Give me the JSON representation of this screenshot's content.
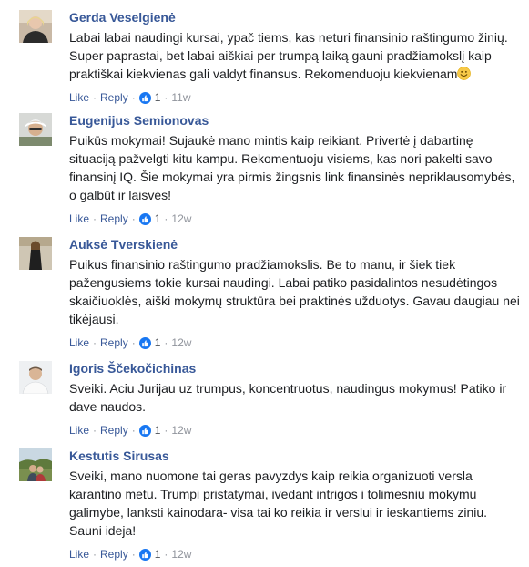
{
  "comments": [
    {
      "author": "Gerda Veselgienė",
      "text": "Labai labai naudingi kursai, ypač tiems, kas neturi finansinio raštingumo žinių. Super paprastai, bet labai aiškiai per trumpą laiką gauni pradžiamokslį kaip praktiškai kiekvienas gali valdyt finansus. Rekomenduoju kiekvienam",
      "emoji": "smiley-emoji-icon",
      "like_label": "Like",
      "reply_label": "Reply",
      "reaction_count": "1",
      "time": "11w"
    },
    {
      "author": "Eugenijus Semionovas",
      "text": "Puikūs mokymai! Sujaukė mano mintis kaip reikiant. Privertė į dabartinę situaciją pažvelgti kitu kampu. Rekomentuoju visiems, kas nori pakelti savo finansinį IQ. Šie mokymai yra pirmis žingsnis link finansinės nepriklausomybės, o galbūt ir laisvės!",
      "like_label": "Like",
      "reply_label": "Reply",
      "reaction_count": "1",
      "time": "12w"
    },
    {
      "author": "Auksė Tverskienė",
      "text": "Puikus finansinio raštingumo pradžiamokslis. Be to manu, ir šiek tiek pažengusiems tokie kursai naudingi. Labai patiko pasidalintos nesudėtingos skaičiuoklės, aiški mokymų struktūra bei praktinės užduotys. Gavau daugiau nei tikėjausi.",
      "like_label": "Like",
      "reply_label": "Reply",
      "reaction_count": "1",
      "time": "12w"
    },
    {
      "author": "Igoris Ščekočichinas",
      "text": "Sveiki. Aciu Jurijau uz trumpus, koncentruotus, naudingus mokymus! Patiko ir dave naudos.",
      "like_label": "Like",
      "reply_label": "Reply",
      "reaction_count": "1",
      "time": "12w"
    },
    {
      "author": "Kestutis Sirusas",
      "text": "Sveiki, mano nuomone tai geras pavyzdys kaip reikia organizuoti versla karantino metu. Trumpi pristatymai, ivedant intrigos i tolimesniu mokymu galimybe, lanksti kainodara- visa tai ko reikia ir verslui ir ieskantiems ziniu. Sauni ideja!",
      "like_label": "Like",
      "reply_label": "Reply",
      "reaction_count": "1",
      "time": "12w"
    }
  ],
  "colors": {
    "name_link": "#385898",
    "body_text": "#1c1e21",
    "meta_text": "#90949c",
    "like_badge": "#1877f2"
  }
}
